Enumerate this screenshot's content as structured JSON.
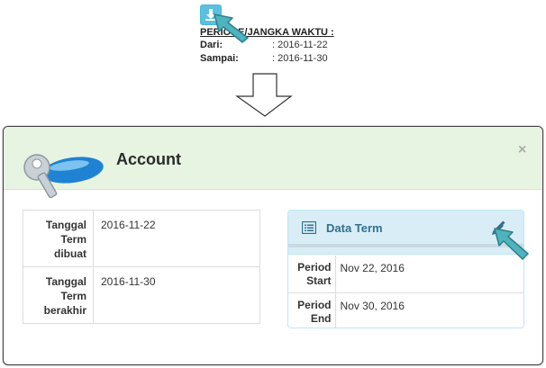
{
  "periode": {
    "title": "PERIODE/JANGKA WAKTU :",
    "from_label": "Dari:",
    "from_value": ": 2016-11-22",
    "to_label": "Sampai:",
    "to_value": ": 2016-11-30"
  },
  "icons": {
    "download": "download-icon",
    "cursor": "arrow-cursor-icon",
    "flow": "down-arrow-icon",
    "key": "key-icon",
    "list": "list-icon",
    "edit": "pencil-icon"
  },
  "modal": {
    "title": "Account",
    "close_label": "×",
    "term_table": [
      {
        "label": "Tanggal Term dibuat",
        "value": "2016-11-22"
      },
      {
        "label": "Tanggal Term berakhir",
        "value": "2016-11-30"
      }
    ],
    "panel": {
      "title": "Data Term",
      "rows": [
        {
          "label": "Period Start",
          "value": "Nov 22, 2016"
        },
        {
          "label": "Period End",
          "value": "Nov 30, 2016"
        }
      ]
    }
  },
  "colors": {
    "info_button": "#5bc0de",
    "header_bg": "#e6f4e1",
    "panel_heading_bg": "#d9edf7",
    "panel_title": "#31708f",
    "cursor_teal": "#4fb3bf"
  }
}
